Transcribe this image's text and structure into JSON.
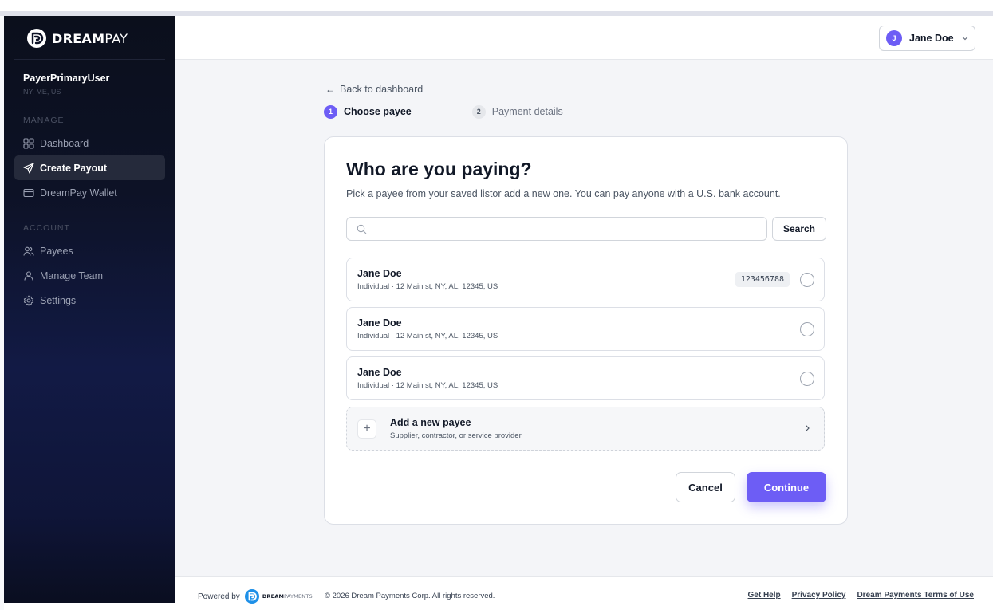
{
  "brand": {
    "name_bold": "DREAM",
    "name_light": "PAY"
  },
  "user": {
    "account_name": "PayerPrimaryUser",
    "location": "NY, ME, US"
  },
  "sidebar": {
    "manage_label": "MANAGE",
    "account_label": "ACCOUNT",
    "items": [
      {
        "label": "Dashboard",
        "icon": "grid-icon",
        "active": false
      },
      {
        "label": "Create Payout",
        "icon": "send-icon",
        "active": true
      },
      {
        "label": "DreamPay Wallet",
        "icon": "wallet-icon",
        "active": false
      },
      {
        "label": "Payees",
        "icon": "users-icon",
        "active": false
      },
      {
        "label": "Manage Team",
        "icon": "user-icon",
        "active": false
      },
      {
        "label": "Settings",
        "icon": "gear-icon",
        "active": false
      }
    ]
  },
  "header": {
    "avatar_initial": "J",
    "user_name": "Jane Doe"
  },
  "nav": {
    "back_label": "Back to dashboard"
  },
  "stepper": {
    "steps": [
      {
        "number": "1",
        "label": "Choose payee",
        "active": true
      },
      {
        "number": "2",
        "label": "Payment details",
        "active": false
      }
    ]
  },
  "card": {
    "title": "Who are you paying?",
    "subtitle": "Pick a payee from your saved listor add a new one. You can pay anyone with a U.S. bank account.",
    "search_placeholder": "",
    "search_button": "Search",
    "payees": [
      {
        "name": "Jane Doe",
        "details": "Individual · 12 Main st, NY, AL, 12345, US",
        "account": "123456788"
      },
      {
        "name": "Jane Doe",
        "details": "Individual · 12 Main st, NY, AL, 12345, US",
        "account": ""
      },
      {
        "name": "Jane Doe",
        "details": "Individual · 12 Main st, NY, AL, 12345, US",
        "account": ""
      }
    ],
    "add_new": {
      "title": "Add a new payee",
      "subtitle": "Supplier, contractor, or service provider"
    },
    "cancel_label": "Cancel",
    "continue_label": "Continue"
  },
  "footer": {
    "powered_by": "Powered by",
    "footer_brand_bold": "DREAM",
    "footer_brand_light": "PAYMENTS",
    "copyright": "© 2026 Dream Payments Corp. All rights reserved.",
    "links": [
      "Get Help",
      "Privacy Policy",
      "Dream Payments Terms of Use"
    ]
  },
  "colors": {
    "accent": "#6d5df5",
    "sidebar_bg": "#0d1226",
    "main_bg": "#f4f5f8"
  }
}
